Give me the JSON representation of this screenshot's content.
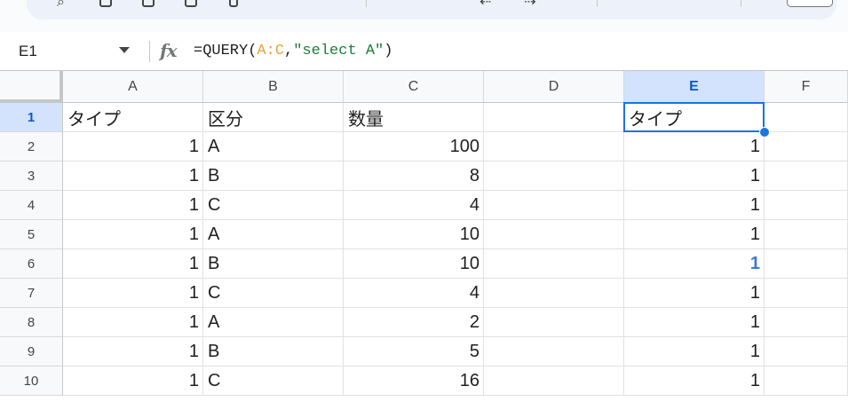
{
  "name_box": {
    "value": "E1"
  },
  "formula_bar": {
    "parts": [
      {
        "text": "=QUERY(",
        "kind": "plain"
      },
      {
        "text": "A:C",
        "kind": "range"
      },
      {
        "text": ",",
        "kind": "plain"
      },
      {
        "text": "\"select A\"",
        "kind": "string"
      },
      {
        "text": ")",
        "kind": "plain"
      }
    ],
    "colors": {
      "range": "#e8a33a",
      "string": "#188038"
    }
  },
  "columns": [
    "A",
    "B",
    "C",
    "D",
    "E",
    "F"
  ],
  "selected_cell": "E1",
  "rows": [
    {
      "num": "1",
      "A": "タイプ",
      "B": "区分",
      "C": "数量",
      "D": "",
      "E": "タイプ"
    },
    {
      "num": "2",
      "A": "1",
      "B": "A",
      "C": "100",
      "D": "",
      "E": "1"
    },
    {
      "num": "3",
      "A": "1",
      "B": "B",
      "C": "8",
      "D": "",
      "E": "1"
    },
    {
      "num": "4",
      "A": "1",
      "B": "C",
      "C": "4",
      "D": "",
      "E": "1"
    },
    {
      "num": "5",
      "A": "1",
      "B": "A",
      "C": "10",
      "D": "",
      "E": "1"
    },
    {
      "num": "6",
      "A": "1",
      "B": "B",
      "C": "10",
      "D": "",
      "E": "1"
    },
    {
      "num": "7",
      "A": "1",
      "B": "C",
      "C": "4",
      "D": "",
      "E": "1"
    },
    {
      "num": "8",
      "A": "1",
      "B": "A",
      "C": "2",
      "D": "",
      "E": "1"
    },
    {
      "num": "9",
      "A": "1",
      "B": "B",
      "C": "5",
      "D": "",
      "E": "1"
    },
    {
      "num": "10",
      "A": "1",
      "B": "C",
      "C": "16",
      "D": "",
      "E": "1"
    }
  ]
}
